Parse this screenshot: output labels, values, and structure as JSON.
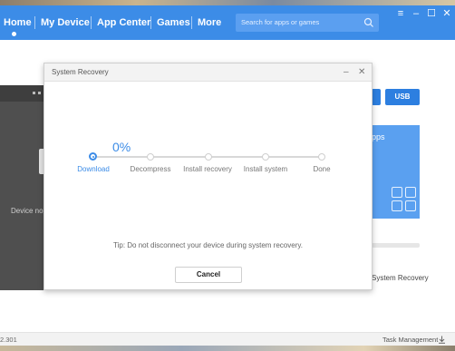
{
  "nav": {
    "items": [
      "Home",
      "My Device",
      "App Center",
      "Games",
      "More"
    ],
    "search_placeholder": "Search for apps or games"
  },
  "window_controls": [
    "≡",
    "–",
    "☐",
    "✕"
  ],
  "background": {
    "device_text": "Device no",
    "btn_partial": "",
    "btn_usb": "USB",
    "card_text": "pps",
    "system_recovery": "System Recovery"
  },
  "dialog": {
    "title": "System Recovery",
    "percent": "0%",
    "steps": [
      "Download",
      "Decompress",
      "Install recovery",
      "Install system",
      "Done"
    ],
    "active_step": 0,
    "tip": "Tip: Do not disconnect your device during system recovery.",
    "cancel_label": "Cancel"
  },
  "footer": {
    "version": "2.301",
    "task_management": "Task Management"
  },
  "colors": {
    "accent": "#3c8ce7",
    "header": "#3c8ce7"
  }
}
